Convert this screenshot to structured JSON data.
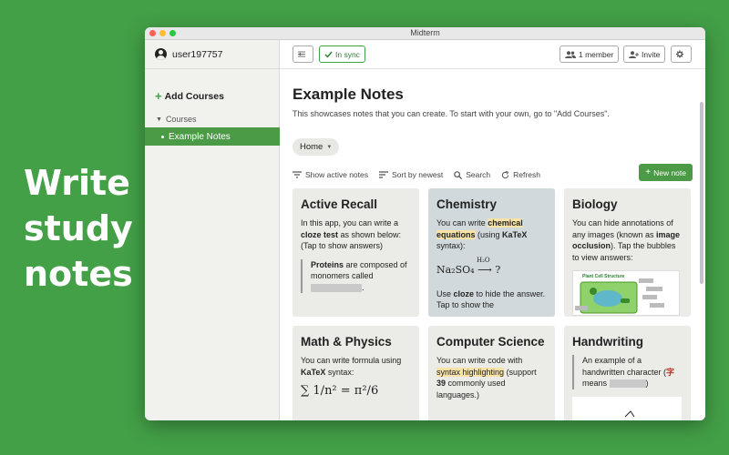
{
  "promo": {
    "lines": [
      "Write",
      "study",
      "notes"
    ]
  },
  "window": {
    "title": "Midterm"
  },
  "sidebar": {
    "username": "user197757",
    "add_courses": "Add Courses",
    "courses_header": "Courses",
    "items": [
      {
        "label": "Example Notes"
      }
    ]
  },
  "toolbar": {
    "sync_label": "In sync",
    "members_label": "1 member",
    "invite_label": "Invite"
  },
  "main": {
    "title": "Example Notes",
    "description": "This showcases notes that you can create. To start with your own, go to \"Add Courses\".",
    "home_label": "Home",
    "actions": {
      "show_active": "Show active notes",
      "sort": "Sort by newest",
      "search": "Search",
      "refresh": "Refresh"
    },
    "new_note": "New note"
  },
  "cards": {
    "active_recall": {
      "title": "Active Recall",
      "t1": "In this app, you can write a ",
      "t1b": "cloze test",
      "t1c": " as shown below: (Tap to show answers)",
      "q1b": "Proteins",
      "q1": " are composed of monomers called ",
      "q1end": "."
    },
    "chemistry": {
      "title": "Chemistry",
      "t1": "You can write ",
      "t1hl": "chemical equations",
      "t1c": " (using ",
      "t1b": "KaTeX",
      "t1d": " syntax):",
      "formula": "Na₂SO₄ ⟶ ?",
      "formula_over": "H₂O",
      "t2": "Use ",
      "t2b": "cloze",
      "t2c": " to hide the answer. Tap to show the"
    },
    "biology": {
      "title": "Biology",
      "t1": "You can hide annotations of any images (known as ",
      "t1b": "image occlusion",
      "t1c": "). Tap the bubbles to view answers:",
      "img_caption": "Plant Cell Structure"
    },
    "math": {
      "title": "Math & Physics",
      "t1": "You can write formula using ",
      "t1b": "KaTeX",
      "t1c": " syntax:",
      "formula": "∑ 1/n² = π²/6"
    },
    "cs": {
      "title": "Computer Science",
      "t1": "You can write code with ",
      "t1hl": "syntax highlighting",
      "t1c": " (support ",
      "t1b": "39",
      "t1d": " commonly used languages.)"
    },
    "handwriting": {
      "title": "Handwriting",
      "t1": "An example of a handwritten character (",
      "char": "字",
      "t1c": " means ",
      "t1end": ")"
    }
  }
}
